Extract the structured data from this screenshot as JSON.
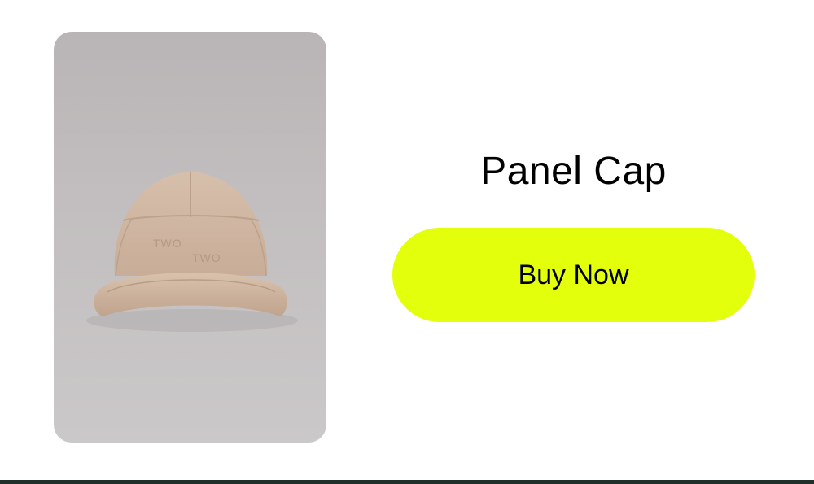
{
  "product": {
    "name": "Panel Cap",
    "image_alt": "Beige five-panel cap with embroidered TWO TWO logo",
    "logo_text_1": "TWO",
    "logo_text_2": "TWO"
  },
  "actions": {
    "buy_label": "Buy Now"
  },
  "colors": {
    "button_accent": "#e4ff0c",
    "cap_color": "#d2b9a4",
    "image_background": "#c2bebf",
    "bottom_bar": "#1f2f2a"
  }
}
